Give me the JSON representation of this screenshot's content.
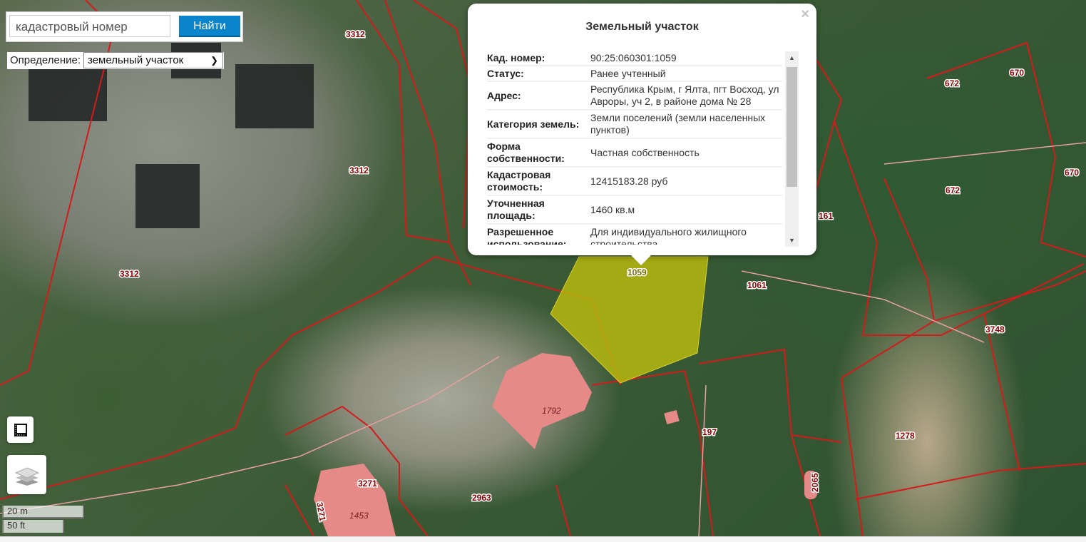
{
  "search": {
    "placeholder": "кадастровый номер",
    "button_label": "Найти"
  },
  "definition": {
    "label": "Определение:",
    "selected": "земельный участок"
  },
  "popup": {
    "title": "Земельный участок",
    "close_glyph": "×",
    "rows": [
      {
        "key": "Кад. номер",
        "value": "90:25:060301:1059"
      },
      {
        "key": "Статус",
        "value": "Ранее учтенный"
      },
      {
        "key": "Адрес",
        "value": "Республика Крым, г Ялта, пгт Восход, ул Авроры, уч 2, в районе дома № 28"
      },
      {
        "key": "Категория земель",
        "value": "Земли поселений (земли населенных пунктов)"
      },
      {
        "key": "Форма собственности",
        "value": "Частная собственность"
      },
      {
        "key": "Кадастровая стоимость",
        "value": "12415183.28 руб"
      },
      {
        "key": "Уточненная площадь",
        "value": "1460 кв.м"
      },
      {
        "key": "Разрешенное использование",
        "value": "Для индивидуального жилищного строительства"
      }
    ]
  },
  "parcel_labels": [
    "3312",
    "3312",
    "3312",
    "672",
    "670",
    "670",
    "672",
    "161",
    "1059",
    "1061",
    "3748",
    "1792",
    "197",
    "1278",
    "2065",
    "3271",
    "3271",
    "1453",
    "2963"
  ],
  "scale": {
    "metric": "20 m",
    "imperial": "50 ft"
  },
  "colors": {
    "boundary": "#d41a1a",
    "selected_parcel": "#b7b80e",
    "building": "#e58a86",
    "button": "#0a85cc"
  }
}
